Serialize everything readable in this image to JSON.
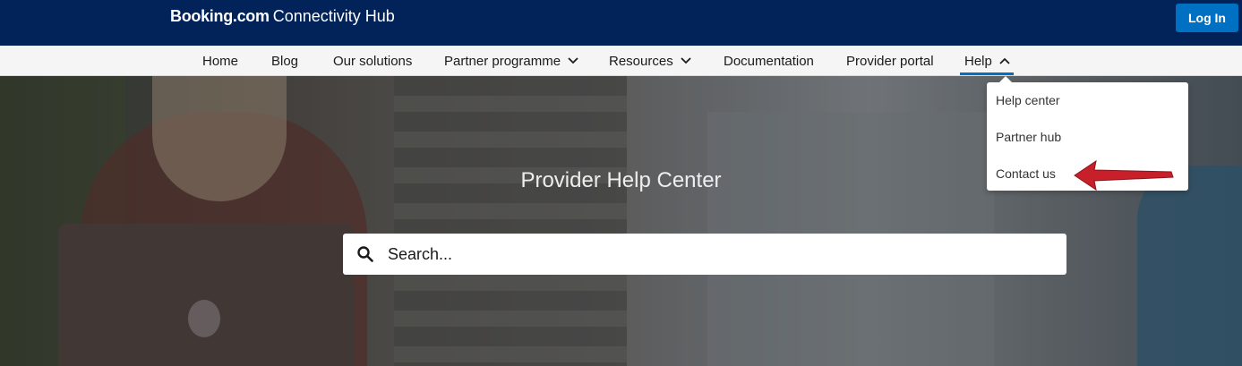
{
  "header": {
    "brand": "Booking.com",
    "subtitle": "Connectivity Hub",
    "login_label": "Log In"
  },
  "nav": {
    "items": [
      {
        "label": "Home"
      },
      {
        "label": "Blog"
      },
      {
        "label": "Our solutions"
      },
      {
        "label": "Partner programme",
        "icon": "chevron-down-icon"
      },
      {
        "label": "Resources",
        "icon": "chevron-down-icon"
      },
      {
        "label": "Documentation"
      },
      {
        "label": "Provider portal"
      },
      {
        "label": "Help",
        "icon": "chevron-up-icon",
        "active": true
      }
    ]
  },
  "help_menu": {
    "items": [
      {
        "label": "Help center"
      },
      {
        "label": "Partner hub"
      },
      {
        "label": "Contact us"
      }
    ]
  },
  "hero": {
    "title": "Provider Help Center",
    "search_placeholder": "Search..."
  },
  "colors": {
    "header_bg": "#012359",
    "primary": "#0071c2",
    "annotation_arrow": "#c8202b"
  }
}
